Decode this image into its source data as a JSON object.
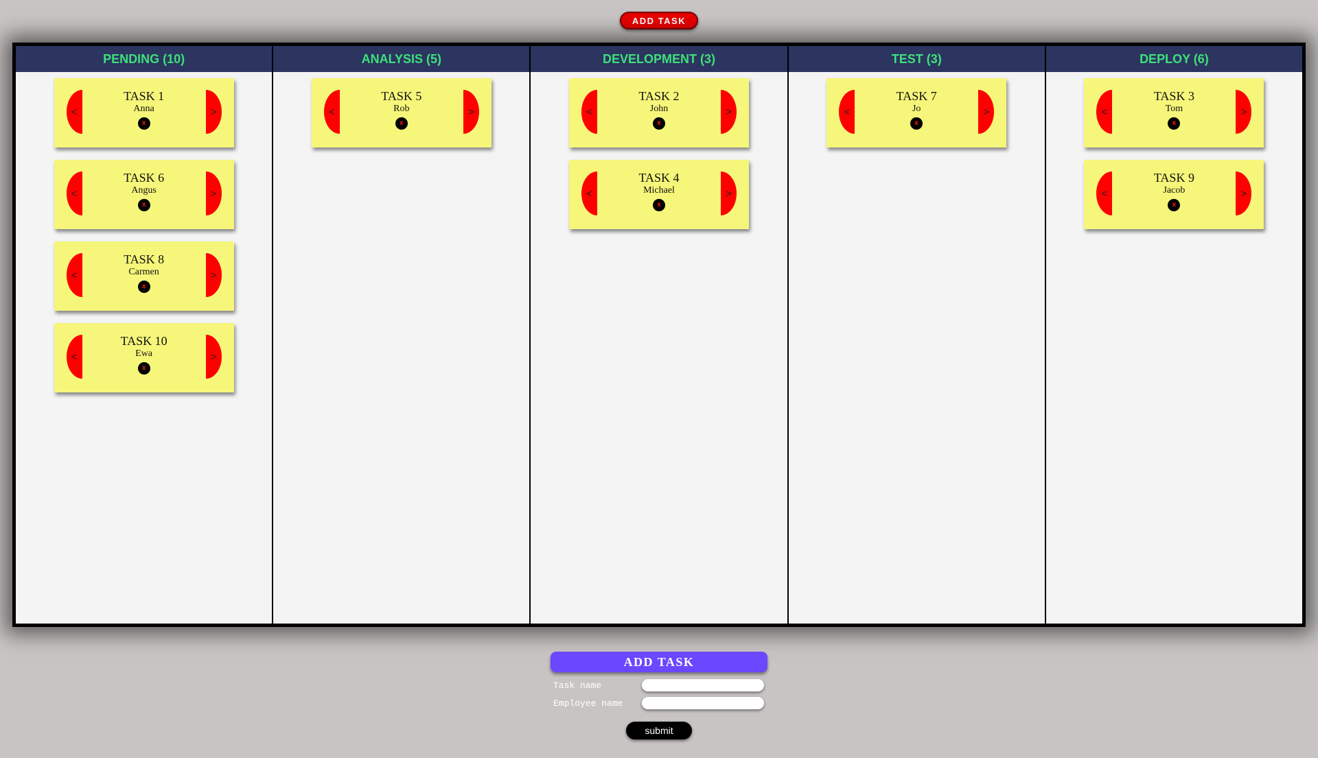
{
  "header": {
    "add_task_label": "ADD TASK"
  },
  "columns": [
    {
      "title": "PENDING (10)",
      "cards": [
        {
          "task": "TASK 1",
          "employee": "Anna"
        },
        {
          "task": "TASK 6",
          "employee": "Angus"
        },
        {
          "task": "TASK 8",
          "employee": "Carmen"
        },
        {
          "task": "TASK 10",
          "employee": "Ewa"
        }
      ]
    },
    {
      "title": "ANALYSIS (5)",
      "cards": [
        {
          "task": "TASK 5",
          "employee": "Rob"
        }
      ]
    },
    {
      "title": "DEVELOPMENT (3)",
      "cards": [
        {
          "task": "TASK 2",
          "employee": "John"
        },
        {
          "task": "TASK 4",
          "employee": "Michael"
        }
      ]
    },
    {
      "title": "TEST (3)",
      "cards": [
        {
          "task": "TASK 7",
          "employee": "Jo"
        }
      ]
    },
    {
      "title": "DEPLOY (6)",
      "cards": [
        {
          "task": "TASK 3",
          "employee": "Tom"
        },
        {
          "task": "TASK 9",
          "employee": "Jacob"
        }
      ]
    }
  ],
  "card_controls": {
    "prev_label": "<",
    "next_label": ">",
    "delete_label": "x"
  },
  "form": {
    "title": "ADD TASK",
    "task_name_label": "Task name",
    "task_name_value": "",
    "employee_name_label": "Employee name",
    "employee_name_value": "",
    "submit_label": "submit"
  },
  "colors": {
    "background": "#c9c4c4",
    "header_bg": "#2b3560",
    "header_text": "#3ee07a",
    "card_bg": "#f6f67a",
    "arrow": "#ff0000",
    "top_button": "#e60000",
    "form_title": "#6b47ff"
  }
}
